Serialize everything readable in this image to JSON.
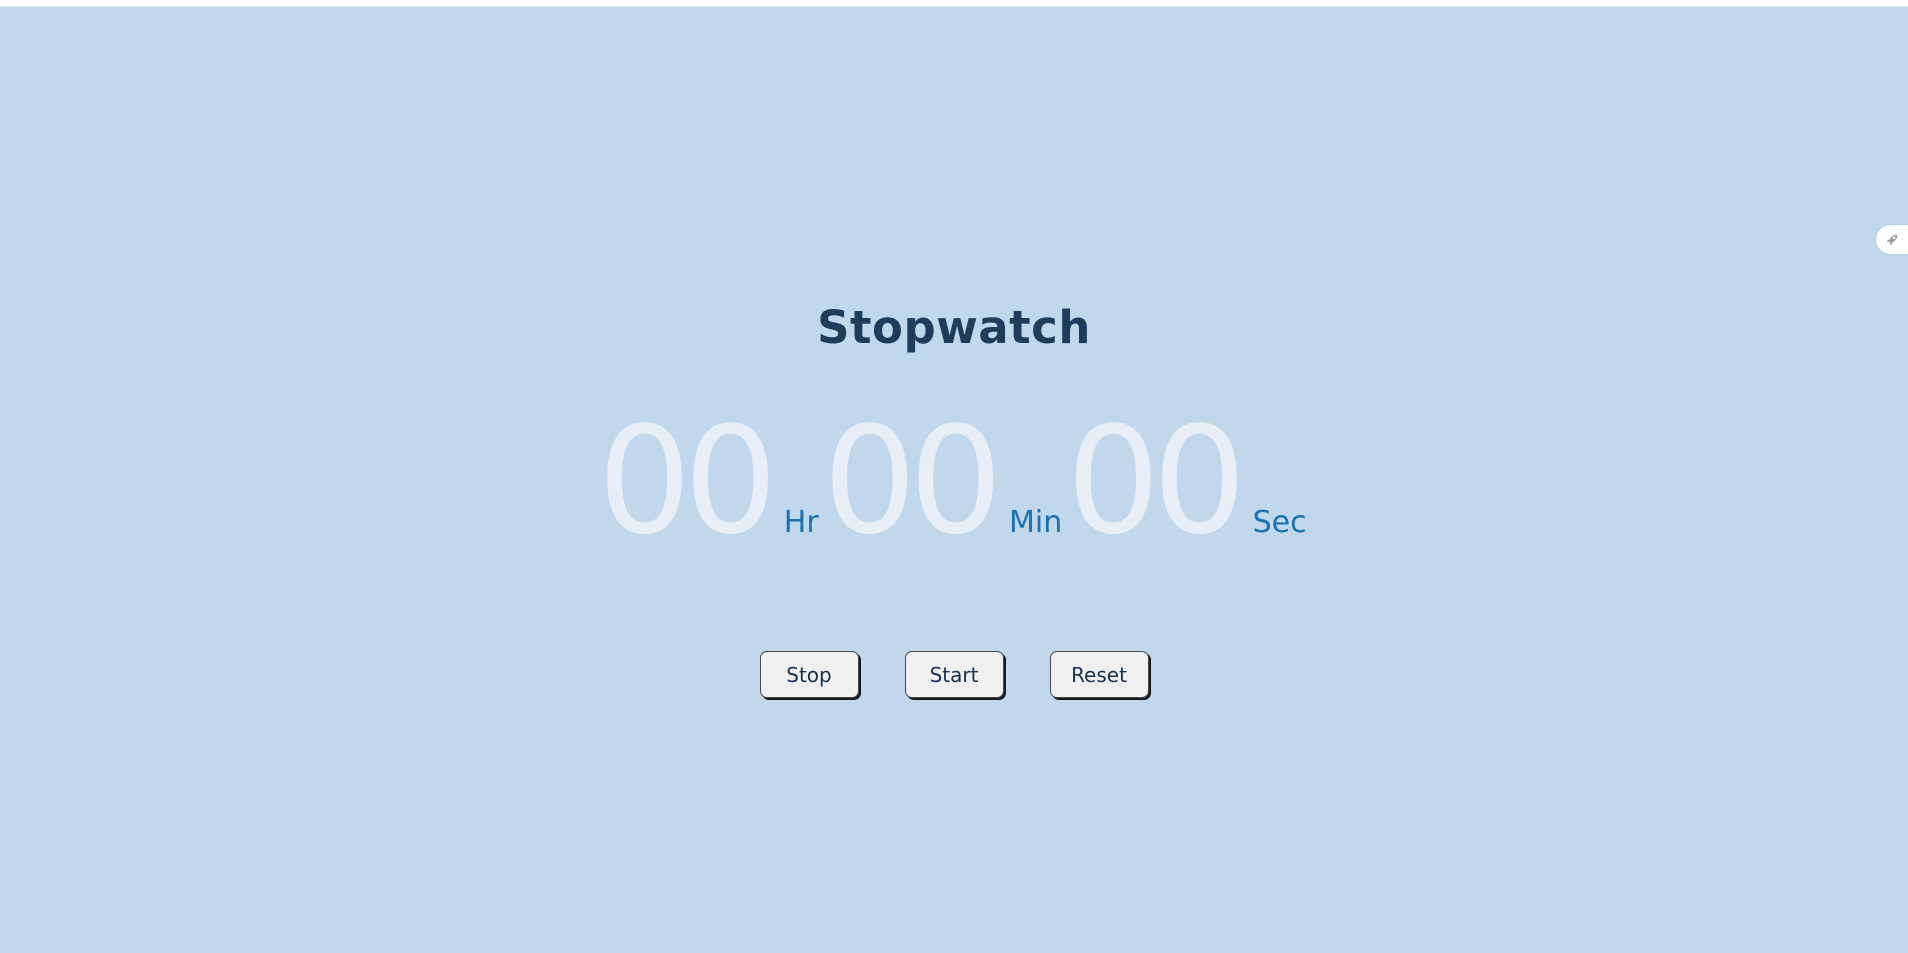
{
  "title": "Stopwatch",
  "time": {
    "hours": "00",
    "hours_unit": "Hr",
    "minutes": "00",
    "minutes_unit": "Min",
    "seconds": "00",
    "seconds_unit": "Sec"
  },
  "buttons": {
    "stop_label": "Stop",
    "start_label": "Start",
    "reset_label": "Reset"
  },
  "side_tool": {
    "icon": "rocket-icon"
  },
  "colors": {
    "background": "#c0d7ec",
    "title": "#1f3d5b",
    "digits": "#e8eef5",
    "units": "#1b72b1",
    "button_bg": "#f0f0f0"
  }
}
